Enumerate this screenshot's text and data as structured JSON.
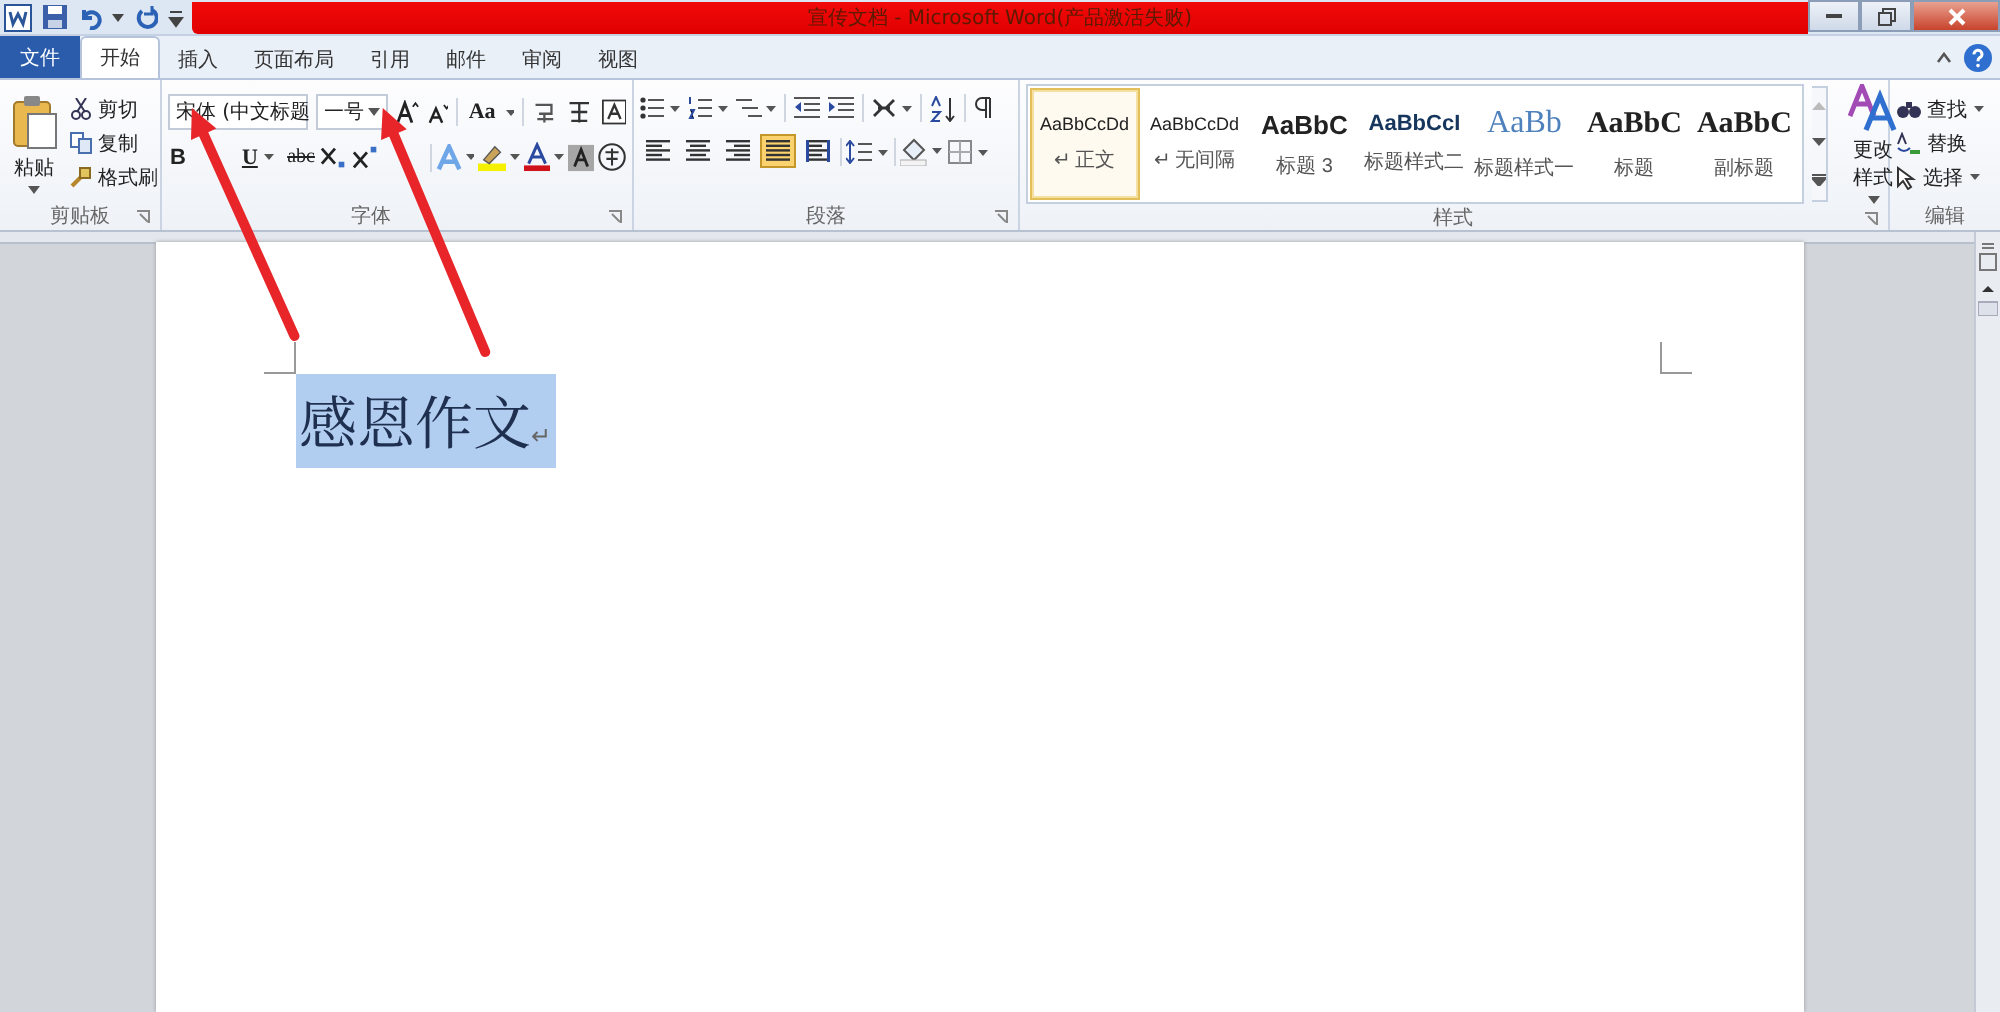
{
  "window": {
    "title": "宣传文档 - Microsoft Word(产品激活失败)"
  },
  "tabs": [
    {
      "label": "文件",
      "kind": "file",
      "selected": false
    },
    {
      "label": "开始",
      "kind": "tab",
      "selected": true
    },
    {
      "label": "插入",
      "kind": "tab",
      "selected": false
    },
    {
      "label": "页面布局",
      "kind": "tab",
      "selected": false
    },
    {
      "label": "引用",
      "kind": "tab",
      "selected": false
    },
    {
      "label": "邮件",
      "kind": "tab",
      "selected": false
    },
    {
      "label": "审阅",
      "kind": "tab",
      "selected": false
    },
    {
      "label": "视图",
      "kind": "tab",
      "selected": false
    }
  ],
  "clipboard": {
    "label": "剪贴板",
    "paste": "粘贴",
    "items": [
      "剪切",
      "复制",
      "格式刷"
    ]
  },
  "font": {
    "label": "字体",
    "font_name": "宋体 (中文标题",
    "font_size": "一号",
    "change_case": "Aa",
    "format_buttons": [
      "B",
      "U",
      "abc"
    ]
  },
  "paragraph": {
    "label": "段落",
    "align_buttons": [
      {
        "selected": false
      },
      {
        "selected": false
      },
      {
        "selected": false
      },
      {
        "selected": true
      },
      {
        "selected": false
      }
    ]
  },
  "styles": {
    "label": "样式",
    "items": [
      {
        "preview": "AaBbCcDd",
        "label": "↵ 正文",
        "kind": "plain",
        "selected": true
      },
      {
        "preview": "AaBbCcDd",
        "label": "↵ 无间隔",
        "kind": "plain",
        "selected": false
      },
      {
        "preview": "AaBbC",
        "label": "标题 3",
        "kind": "bold",
        "selected": false
      },
      {
        "preview": "AaBbCcI",
        "label": "标题样式二",
        "kind": "blue",
        "selected": false
      },
      {
        "preview": "AaBb",
        "label": "标题样式一",
        "kind": "light",
        "selected": false
      },
      {
        "preview": "AaBbC",
        "label": "标题",
        "kind": "serif",
        "selected": false
      },
      {
        "preview": "AaBbC",
        "label": "副标题",
        "kind": "serif",
        "selected": false
      }
    ],
    "change_styles": "更改样式"
  },
  "editing": {
    "label": "编辑",
    "items": [
      "查找",
      "替换",
      "选择"
    ]
  },
  "document": {
    "text": "感恩作文",
    "mark": "↵",
    "selected": true
  }
}
